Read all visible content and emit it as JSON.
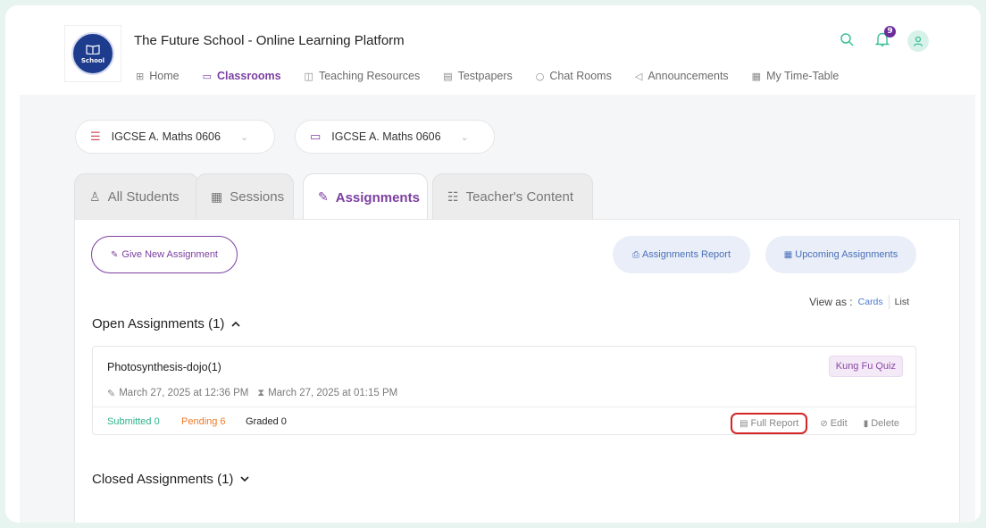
{
  "header": {
    "logo_text": "School",
    "title": "The Future School - Online Learning Platform",
    "notification_count": "9"
  },
  "nav": [
    {
      "label": "Home",
      "icon": "grid-icon",
      "glyph": "⊞"
    },
    {
      "label": "Classrooms",
      "icon": "monitor-icon",
      "glyph": "⎚",
      "active": true
    },
    {
      "label": "Teaching Resources",
      "icon": "book-icon",
      "glyph": "🕮"
    },
    {
      "label": "Testpapers",
      "icon": "document-icon",
      "glyph": "🖹"
    },
    {
      "label": "Chat Rooms",
      "icon": "chat-icon",
      "glyph": "◯"
    },
    {
      "label": "Announcements",
      "icon": "megaphone-icon",
      "glyph": "📢"
    },
    {
      "label": "My Time-Table",
      "icon": "calendar-icon",
      "glyph": "▤"
    }
  ],
  "filters": {
    "subject": "IGCSE A. Maths 0606",
    "classroom": "IGCSE A. Maths 0606"
  },
  "tabs": [
    {
      "label": "All Students",
      "icon": "students-icon"
    },
    {
      "label": "Sessions",
      "icon": "calendar-icon"
    },
    {
      "label": "Assignments",
      "icon": "pen-icon",
      "active": true
    },
    {
      "label": "Teacher's Content",
      "icon": "teacher-icon"
    }
  ],
  "actions": {
    "give_new": "Give New Assignment",
    "report": "Assignments Report",
    "upcoming": "Upcoming Assignments"
  },
  "view_as": {
    "label": "View as :",
    "cards": "Cards",
    "list": "List"
  },
  "open_section": {
    "title": "Open Assignments (1)"
  },
  "assignment": {
    "title": "Photosynthesis-dojo(1)",
    "tag": "Kung Fu Quiz",
    "start": "March 27, 2025 at 12:36 PM",
    "end": "March 27, 2025 at 01:15 PM",
    "submitted": "Submitted 0",
    "pending": "Pending 6",
    "graded": "Graded 0",
    "full_report": "Full Report",
    "edit": "Edit",
    "delete": "Delete"
  },
  "closed_section": {
    "title": "Closed Assignments (1)"
  },
  "colors": {
    "accent": "#7b3fa0",
    "teal": "#3bbf9a",
    "submitted": "#2db38a",
    "pending": "#f07a2a",
    "highlight": "#d42525"
  }
}
